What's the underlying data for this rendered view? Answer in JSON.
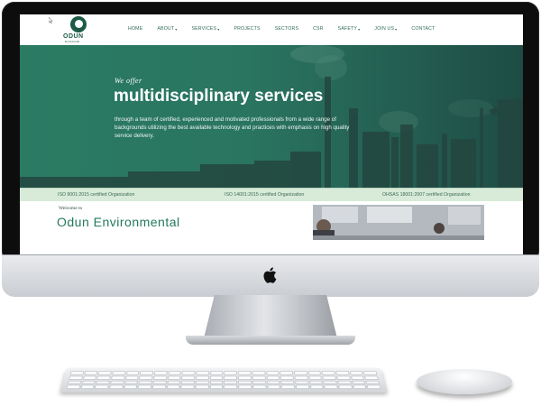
{
  "site": {
    "logo_text": "ODUN",
    "logo_sub": "Environmental",
    "nav": [
      {
        "label": "HOME",
        "dropdown": false
      },
      {
        "label": "ABOUT",
        "dropdown": true
      },
      {
        "label": "SERVICES",
        "dropdown": true
      },
      {
        "label": "PROJECTS",
        "dropdown": false
      },
      {
        "label": "SECTORS",
        "dropdown": false
      },
      {
        "label": "CSR",
        "dropdown": false
      },
      {
        "label": "SAFETY",
        "dropdown": true
      },
      {
        "label": "JOIN US",
        "dropdown": true
      },
      {
        "label": "CONTACT",
        "dropdown": false
      }
    ],
    "caret": "▾"
  },
  "hero": {
    "pretitle": "We offer",
    "title": "multidisciplinary services",
    "description": "through a team of certified, experienced and motivated professionals from a wide range of backgrounds utilizing the best available technology and practices with emphasis on high quality service delivery."
  },
  "certifications": [
    "ISO 9001:2015 certified Organization",
    "ISO 14001:2015 certified Organization",
    "OHSAS 18001:2007 certified Organization"
  ],
  "welcome": {
    "label": "Welcome to",
    "title": "Odun Environmental"
  },
  "colors": {
    "brand_green": "#1c5b46",
    "hero_green": "#2b7b63",
    "cert_strip": "#d7ebd8"
  },
  "icons": {
    "apple": "apple-logo-icon",
    "cursor": "mouse-pointer-icon"
  }
}
